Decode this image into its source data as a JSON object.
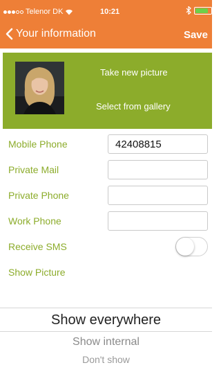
{
  "status_bar": {
    "carrier": "Telenor DK",
    "time": "10:21",
    "signal_dots_filled": 3,
    "signal_dots_total": 5,
    "battery_level": 0.8
  },
  "nav": {
    "title": "Your information",
    "save_label": "Save",
    "bar_color": "#ee7f37"
  },
  "photo": {
    "take_new": "Take new picture",
    "gallery": "Select from gallery",
    "band_color": "#8cac2b"
  },
  "form": {
    "mobile_phone": {
      "label": "Mobile Phone",
      "value": "42408815"
    },
    "private_mail": {
      "label": "Private Mail",
      "value": ""
    },
    "private_phone": {
      "label": "Private Phone",
      "value": ""
    },
    "work_phone": {
      "label": "Work Phone",
      "value": ""
    },
    "receive_sms": {
      "label": "Receive SMS",
      "on": false
    },
    "show_picture": {
      "label": "Show Picture"
    }
  },
  "visibility_picker": {
    "options": [
      "Show everywhere",
      "Show internal",
      "Don't show"
    ],
    "selected": "Show everywhere"
  }
}
